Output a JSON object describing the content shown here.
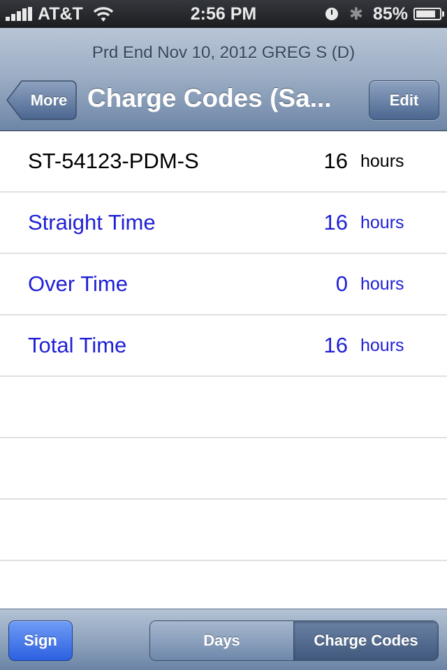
{
  "status_bar": {
    "carrier": "AT&T",
    "time": "2:56 PM",
    "battery_percent": "85%",
    "battery_level": 0.85,
    "icons": [
      "signal-icon",
      "wifi-icon",
      "alarm-clock-icon",
      "bluetooth-icon",
      "battery-icon"
    ]
  },
  "nav": {
    "prompt": "Prd End Nov 10, 2012 GREG S (D)",
    "title": "Charge Codes (Sa...",
    "back_label": "More",
    "edit_label": "Edit"
  },
  "rows": [
    {
      "label": "ST-54123-PDM-S",
      "value": "16",
      "unit": "hours",
      "color": "#000000"
    },
    {
      "label": "Straight Time",
      "value": "16",
      "unit": "hours",
      "color": "#1f1fd6"
    },
    {
      "label": "Over Time",
      "value": "0",
      "unit": "hours",
      "color": "#1f1fd6"
    },
    {
      "label": "Total Time",
      "value": "16",
      "unit": "hours",
      "color": "#1f1fd6"
    }
  ],
  "toolbar": {
    "sign_label": "Sign",
    "segments": [
      {
        "label": "Days",
        "selected": false
      },
      {
        "label": "Charge Codes",
        "selected": true
      }
    ]
  },
  "colors": {
    "accent_blue": "#1f1fd6",
    "nav_bar": "#9eafc5",
    "sign_button": "#2c60e0"
  }
}
